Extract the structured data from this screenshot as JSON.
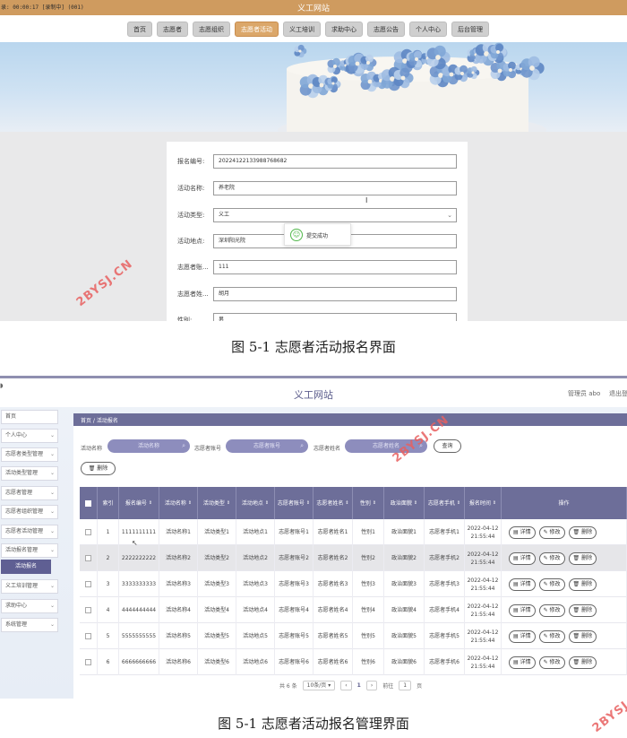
{
  "shot1": {
    "window_title": "义工网站",
    "recording_text": "录: 00:00:17 [录制中] (001)",
    "nav_items": [
      "首页",
      "志愿者",
      "志愿组织",
      "志愿者活动",
      "义工培训",
      "求助中心",
      "志愿公告",
      "个人中心",
      "后台管理"
    ],
    "nav_active_index": 3,
    "form": {
      "fields": [
        {
          "label": "报名编号:",
          "value": "20224122133988768682"
        },
        {
          "label": "活动名称:",
          "value": "养老院"
        },
        {
          "label": "活动类型:",
          "value": "义工",
          "type": "select"
        },
        {
          "label": "活动地点:",
          "value": "深圳阳光院"
        },
        {
          "label": "志愿者账...",
          "value": "111"
        },
        {
          "label": "志愿者姓...",
          "value": "胡月"
        },
        {
          "label": "性别:",
          "value": "男"
        }
      ]
    },
    "toast": {
      "message": "提交成功",
      "icon": "smile-icon"
    }
  },
  "caption1": "图 5-1 志愿者活动报名界面",
  "watermark": "2BYSJ.CN",
  "shot2": {
    "header_title": "义工网站",
    "admin_label": "管理员 abo",
    "logout_label": "退出登",
    "home_glyph": "◗",
    "sidebar": [
      {
        "label": "首页",
        "has_chevron": false
      },
      {
        "label": "个人中心",
        "has_chevron": true
      },
      {
        "label": "志愿者类型管理",
        "has_chevron": true
      },
      {
        "label": "活动类型管理",
        "has_chevron": true
      },
      {
        "label": "志愿者管理",
        "has_chevron": true
      },
      {
        "label": "志愿者组织管理",
        "has_chevron": true
      },
      {
        "label": "志愿者活动管理",
        "has_chevron": true
      },
      {
        "label": "活动报名管理",
        "has_chevron": true
      },
      {
        "label": "活动报名",
        "sub": true
      },
      {
        "label": "义工培训管理",
        "has_chevron": true
      },
      {
        "label": "求助中心",
        "has_chevron": true
      },
      {
        "label": "系统管理",
        "has_chevron": true
      }
    ],
    "breadcrumb": "首页 / 活动报名",
    "filters": [
      {
        "label": "活动名称",
        "placeholder": "活动名称"
      },
      {
        "label": "志愿者账号",
        "placeholder": "志愿者账号"
      },
      {
        "label": "志愿者姓名",
        "placeholder": "志愿者姓名"
      }
    ],
    "search_button": "查询",
    "delete_button": "删除",
    "columns": [
      "",
      "索引",
      "报名编号",
      "活动名称",
      "活动类型",
      "活动地点",
      "志愿者账号",
      "志愿者姓名",
      "性别",
      "政治面貌",
      "志愿者手机",
      "报名时间",
      "操作"
    ],
    "sortable": [
      false,
      false,
      true,
      true,
      true,
      true,
      true,
      true,
      true,
      true,
      true,
      true,
      false
    ],
    "rows": [
      [
        "1",
        "1111111111",
        "活动名称1",
        "活动类型1",
        "活动地点1",
        "志愿者账号1",
        "志愿者姓名1",
        "性别1",
        "政治面貌1",
        "志愿者手机1",
        "2022-04-12 21:55:44"
      ],
      [
        "2",
        "2222222222",
        "活动名称2",
        "活动类型2",
        "活动地点2",
        "志愿者账号2",
        "志愿者姓名2",
        "性别2",
        "政治面貌2",
        "志愿者手机2",
        "2022-04-12 21:55:44"
      ],
      [
        "3",
        "3333333333",
        "活动名称3",
        "活动类型3",
        "活动地点3",
        "志愿者账号3",
        "志愿者姓名3",
        "性别3",
        "政治面貌3",
        "志愿者手机3",
        "2022-04-12 21:55:44"
      ],
      [
        "4",
        "4444444444",
        "活动名称4",
        "活动类型4",
        "活动地点4",
        "志愿者账号4",
        "志愿者姓名4",
        "性别4",
        "政治面貌4",
        "志愿者手机4",
        "2022-04-12 21:55:44"
      ],
      [
        "5",
        "5555555555",
        "活动名称5",
        "活动类型5",
        "活动地点5",
        "志愿者账号5",
        "志愿者姓名5",
        "性别5",
        "政治面貌5",
        "志愿者手机5",
        "2022-04-12 21:55:44"
      ],
      [
        "6",
        "6666666666",
        "活动名称6",
        "活动类型6",
        "活动地点6",
        "志愿者账号6",
        "志愿者姓名6",
        "性别6",
        "政治面貌6",
        "志愿者手机6",
        "2022-04-12 21:55:44"
      ]
    ],
    "row_actions": [
      "详情",
      "修改",
      "删除"
    ],
    "pager": {
      "total": "共 6 条",
      "page_size": "10条/页",
      "prev": "‹",
      "current": "1",
      "next": "›",
      "goto_label": "前往",
      "goto_value": "1",
      "page_unit": "页"
    }
  },
  "caption2": "图 5-1 志愿者活动报名管理界面"
}
